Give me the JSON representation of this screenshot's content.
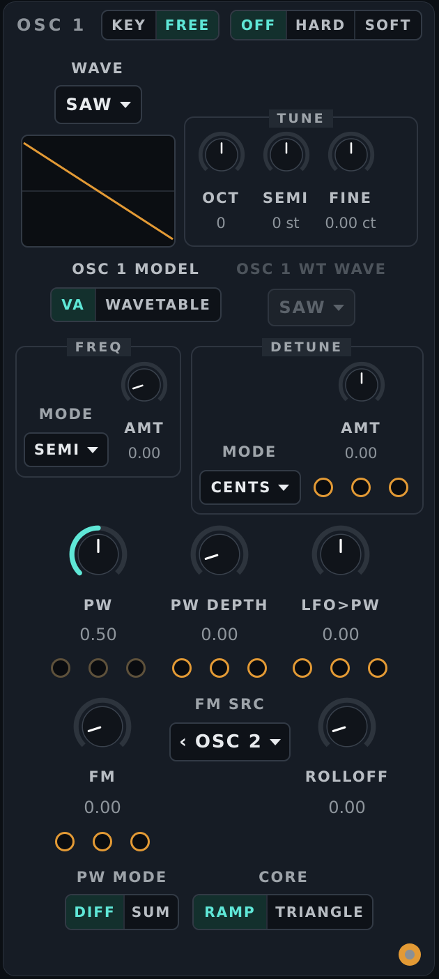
{
  "header": {
    "title": "OSC 1",
    "key_mode": {
      "options": [
        "KEY",
        "FREE"
      ],
      "selected": "FREE"
    },
    "sync": {
      "options": [
        "OFF",
        "HARD",
        "SOFT"
      ],
      "selected": "OFF"
    }
  },
  "wave": {
    "label": "WAVE",
    "value": "SAW"
  },
  "tune": {
    "title": "TUNE",
    "oct": {
      "label": "OCT",
      "value": "0"
    },
    "semi": {
      "label": "SEMI",
      "value": "0 st"
    },
    "fine": {
      "label": "FINE",
      "value": "0.00 ct"
    }
  },
  "model": {
    "label": "OSC 1 MODEL",
    "options": [
      "VA",
      "WAVETABLE"
    ],
    "selected": "VA",
    "wt_label": "OSC 1 WT WAVE",
    "wt_value": "SAW"
  },
  "freq": {
    "title": "FREQ",
    "mode_label": "MODE",
    "mode_value": "SEMI",
    "amt_label": "AMT",
    "amt_value": "0.00"
  },
  "detune": {
    "title": "DETUNE",
    "mode_label": "MODE",
    "mode_value": "CENTS",
    "amt_label": "AMT",
    "amt_value": "0.00"
  },
  "pw": {
    "label": "PW",
    "value": "0.50",
    "level": 0.5
  },
  "pw_depth": {
    "label": "PW DEPTH",
    "value": "0.00"
  },
  "lfo_pw": {
    "label": "LFO>PW",
    "value": "0.00"
  },
  "fm": {
    "label": "FM",
    "value": "0.00"
  },
  "fm_src": {
    "label": "FM SRC",
    "value": "OSC 2"
  },
  "rolloff": {
    "label": "ROLLOFF",
    "value": "0.00"
  },
  "pw_mode": {
    "label": "PW MODE",
    "options": [
      "DIFF",
      "SUM"
    ],
    "selected": "DIFF"
  },
  "core": {
    "label": "CORE",
    "options": [
      "RAMP",
      "TRIANGLE"
    ],
    "selected": "RAMP"
  },
  "colors": {
    "accent": "#5fe7d7",
    "port": "#e39a35",
    "panel": "#161c25",
    "wave": "#e39a35"
  }
}
